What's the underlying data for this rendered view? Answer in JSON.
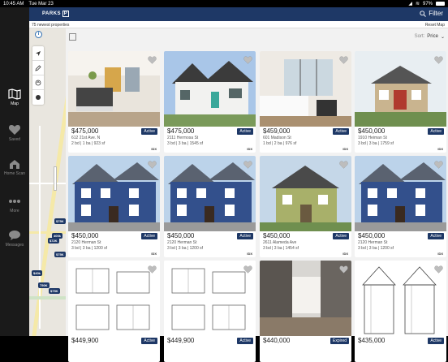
{
  "status": {
    "time": "10:45 AM",
    "date": "Tue Mar 23",
    "battery": "97%",
    "battery_level": 0.97
  },
  "sidebar": {
    "items": [
      {
        "label": "Map",
        "icon": "map-icon",
        "active": true
      },
      {
        "label": "Saved",
        "icon": "heart-icon",
        "active": false
      },
      {
        "label": "Home Scan",
        "icon": "house-scan-icon",
        "active": false
      },
      {
        "label": "More",
        "icon": "more-dots-icon",
        "active": false
      },
      {
        "label": "Messages",
        "icon": "chat-icon",
        "active": false
      }
    ]
  },
  "topbar": {
    "logo": "PARKS",
    "logo_mark": "P",
    "filter_label": "Filter"
  },
  "subbar": {
    "count": "75 newest properties",
    "reset": "Reset Map"
  },
  "map": {
    "pins": [
      "$75K",
      "400k",
      "$72K",
      "$75K",
      "$40k",
      "750K",
      "$75K"
    ]
  },
  "list": {
    "sort_label": "Sort:",
    "sort_value": "Price"
  },
  "cards": [
    {
      "price": "$475,000",
      "status": "Active",
      "address": "612 21st Ave. N",
      "meta": "2 bd | 1 ba | 923 sf",
      "idx": "IDX",
      "scene": "interior"
    },
    {
      "price": "$475,000",
      "status": "Active",
      "address": "2111 Hermosa St",
      "meta": "3 bd | 3 ba | 1545 sf",
      "idx": "IDX",
      "scene": "white-house"
    },
    {
      "price": "$459,000",
      "status": "Active",
      "address": "601 Madison St",
      "meta": "1 bd | 2 ba | 976 sf",
      "idx": "IDX",
      "scene": "interior2"
    },
    {
      "price": "$450,000",
      "status": "Active",
      "address": "1910 Heiman St",
      "meta": "3 bd | 3 ba | 1759 sf",
      "idx": "IDX",
      "scene": "tan-house"
    },
    {
      "price": "$450,000",
      "status": "Active",
      "address": "2120 Herman St",
      "meta": "3 bd | 3 ba | 1200 sf",
      "idx": "IDX",
      "scene": "blue-house"
    },
    {
      "price": "$450,000",
      "status": "Active",
      "address": "2120 Herman St",
      "meta": "3 bd | 3 ba | 1200 sf",
      "idx": "IDX",
      "scene": "blue-house"
    },
    {
      "price": "$450,000",
      "status": "Active",
      "address": "2611 Alameda Ave",
      "meta": "3 bd | 3 ba | 1454 sf",
      "idx": "IDX",
      "scene": "green-house"
    },
    {
      "price": "$450,000",
      "status": "Active",
      "address": "2120 Herman St",
      "meta": "3 bd | 3 ba | 1200 sf",
      "idx": "IDX",
      "scene": "blue-house"
    },
    {
      "price": "$449,900",
      "status": "Active",
      "address": "",
      "meta": "",
      "idx": "",
      "scene": "plan"
    },
    {
      "price": "$449,900",
      "status": "Active",
      "address": "",
      "meta": "",
      "idx": "",
      "scene": "plan"
    },
    {
      "price": "$440,000",
      "status": "Expired",
      "address": "",
      "meta": "",
      "idx": "",
      "scene": "kitchen"
    },
    {
      "price": "$435,000",
      "status": "Active",
      "address": "",
      "meta": "",
      "idx": "",
      "scene": "elevation"
    }
  ]
}
